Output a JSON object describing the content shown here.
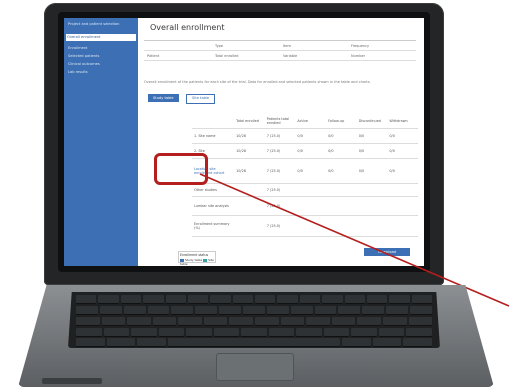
{
  "sidebar": {
    "items": [
      {
        "label": "Project and patient selection",
        "active": false
      },
      {
        "label": "Overall enrollment",
        "active": true
      },
      {
        "label": "Enrollment",
        "active": false
      },
      {
        "label": "Selected patients",
        "active": false
      },
      {
        "label": "Clinical outcomes",
        "active": false
      },
      {
        "label": "Lab results",
        "active": false
      }
    ]
  },
  "page": {
    "title": "Overall enrollment",
    "summary_headers": [
      "Type",
      "Item",
      "Frequency"
    ],
    "summary_row": [
      "Patient",
      "Total enrolled",
      "Variable",
      "Number"
    ],
    "description": "Overall enrollment of the patients for each site of the trial. Data for enrolled and selected patients shown in the table and charts.",
    "btn_study_table": "Study table",
    "btn_site_table": "Site table",
    "download_label": "Download"
  },
  "table": {
    "headers": [
      "",
      "Total enrolled",
      "Patients total enrolled",
      "Active",
      "Follow-up",
      "Discontinued",
      "Withdrawn"
    ],
    "rows": [
      [
        "1. Site name",
        "10/28",
        "7 (25.0)",
        "0/0",
        "0/0",
        "0/0",
        "0/0"
      ],
      [
        "2. Site",
        "10/28",
        "7 (25.0)",
        "0/0",
        "0/0",
        "0/0",
        "0/0"
      ],
      [
        "Location site enrollment cohort",
        "10/28",
        "7 (25.0)",
        "0/0",
        "0/0",
        "0/0",
        "0/0"
      ],
      [
        "Other studies",
        "",
        "7 (25.0)",
        "",
        "",
        "",
        ""
      ],
      [
        "Lumbar site analysis",
        "",
        "7 (25.0)",
        "",
        "",
        "",
        ""
      ],
      [
        "Enrollment summary (%)",
        "",
        "7 (25.0)",
        "",
        "",
        "",
        ""
      ]
    ]
  },
  "legend": {
    "title": "Enrollment status",
    "items": [
      {
        "label": "Study table",
        "color": "#3c6fb4"
      },
      {
        "label": "Site table",
        "color": "#35a3a0"
      }
    ]
  },
  "colors": {
    "accent": "#3c6fb4",
    "highlight": "#b41e1e"
  }
}
